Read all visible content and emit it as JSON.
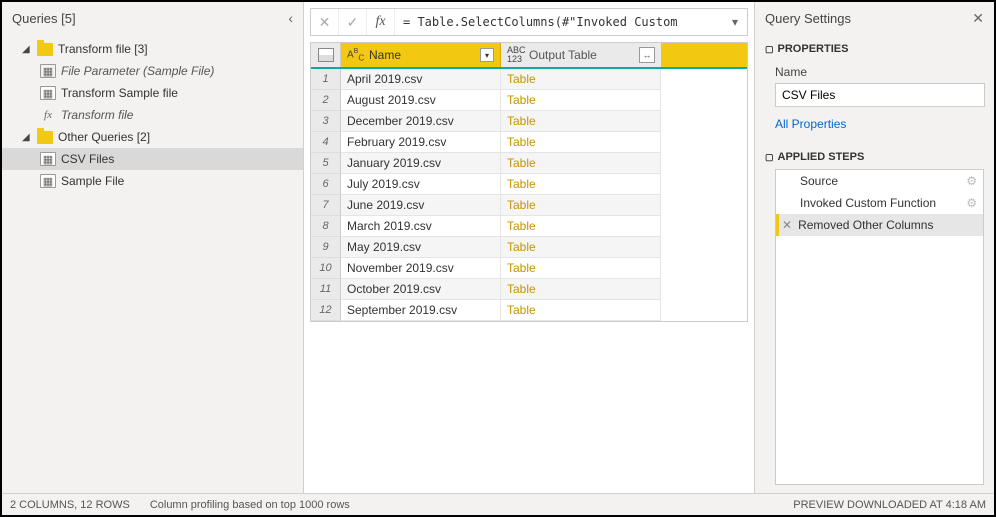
{
  "queriesPanel": {
    "title": "Queries [5]",
    "groups": [
      {
        "label": "Transform file [3]",
        "children": [
          {
            "label": "File Parameter (Sample File)",
            "type": "param",
            "italic": true
          },
          {
            "label": "Transform Sample file",
            "type": "table"
          },
          {
            "label": "Transform file",
            "type": "fx",
            "italic": true
          }
        ]
      },
      {
        "label": "Other Queries [2]",
        "children": [
          {
            "label": "CSV Files",
            "type": "table",
            "selected": true
          },
          {
            "label": "Sample File",
            "type": "table"
          }
        ]
      }
    ]
  },
  "formula": "= Table.SelectColumns(#\"Invoked Custom",
  "grid": {
    "columns": {
      "name": "Name",
      "output": "Output Table"
    },
    "rows": [
      {
        "n": 1,
        "name": "April 2019.csv",
        "out": "Table"
      },
      {
        "n": 2,
        "name": "August 2019.csv",
        "out": "Table"
      },
      {
        "n": 3,
        "name": "December 2019.csv",
        "out": "Table"
      },
      {
        "n": 4,
        "name": "February 2019.csv",
        "out": "Table"
      },
      {
        "n": 5,
        "name": "January 2019.csv",
        "out": "Table"
      },
      {
        "n": 6,
        "name": "July 2019.csv",
        "out": "Table"
      },
      {
        "n": 7,
        "name": "June 2019.csv",
        "out": "Table"
      },
      {
        "n": 8,
        "name": "March 2019.csv",
        "out": "Table"
      },
      {
        "n": 9,
        "name": "May 2019.csv",
        "out": "Table"
      },
      {
        "n": 10,
        "name": "November 2019.csv",
        "out": "Table"
      },
      {
        "n": 11,
        "name": "October 2019.csv",
        "out": "Table"
      },
      {
        "n": 12,
        "name": "September 2019.csv",
        "out": "Table"
      }
    ]
  },
  "settings": {
    "title": "Query Settings",
    "propHeader": "PROPERTIES",
    "nameLabel": "Name",
    "nameValue": "CSV Files",
    "allProps": "All Properties",
    "stepsHeader": "APPLIED STEPS",
    "steps": [
      {
        "label": "Source",
        "gear": true
      },
      {
        "label": "Invoked Custom Function",
        "gear": true
      },
      {
        "label": "Removed Other Columns",
        "selected": true,
        "del": true
      }
    ]
  },
  "status": {
    "left1": "2 COLUMNS, 12 ROWS",
    "left2": "Column profiling based on top 1000 rows",
    "right": "PREVIEW DOWNLOADED AT 4:18 AM"
  }
}
